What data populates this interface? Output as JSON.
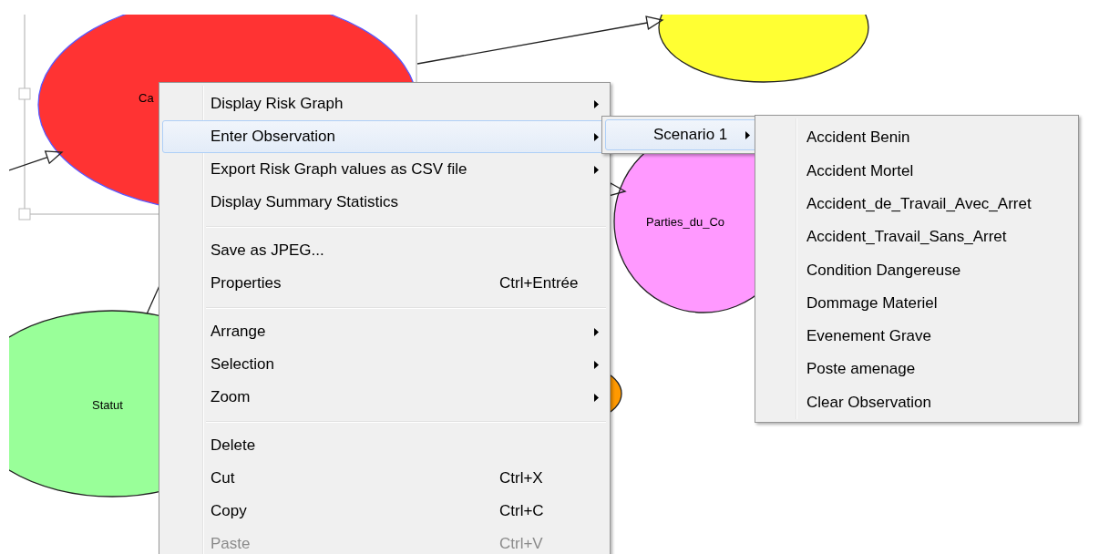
{
  "canvas": {
    "nodes": [
      {
        "label": "Ca",
        "color": "#ff3333",
        "selected": true
      },
      {
        "color": "#ffff33",
        "selected": false
      },
      {
        "label": "Parties_du_Co",
        "color": "#ff99ff",
        "selected": false
      },
      {
        "label": "Statut",
        "color": "#99ff99",
        "selected": false
      },
      {
        "color": "#ff9900",
        "selected": false
      }
    ]
  },
  "context_menu": {
    "items": [
      {
        "kind": "item",
        "label": "Display Risk Graph",
        "submenu": true,
        "highlighted": false,
        "disabled": false
      },
      {
        "kind": "item",
        "label": "Enter Observation",
        "submenu": true,
        "highlighted": true,
        "disabled": false
      },
      {
        "kind": "item",
        "label": "Export Risk Graph values as CSV file",
        "submenu": true,
        "highlighted": false,
        "disabled": false
      },
      {
        "kind": "item",
        "label": "Display Summary Statistics",
        "submenu": false,
        "highlighted": false,
        "disabled": false
      },
      {
        "kind": "separator"
      },
      {
        "kind": "item",
        "label": "Save as JPEG...",
        "submenu": false,
        "highlighted": false,
        "disabled": false
      },
      {
        "kind": "item",
        "label": "Properties",
        "shortcut": "Ctrl+Entrée",
        "submenu": false,
        "highlighted": false,
        "disabled": false
      },
      {
        "kind": "separator"
      },
      {
        "kind": "item",
        "label": "Arrange",
        "submenu": true,
        "highlighted": false,
        "disabled": false
      },
      {
        "kind": "item",
        "label": "Selection",
        "submenu": true,
        "highlighted": false,
        "disabled": false
      },
      {
        "kind": "item",
        "label": "Zoom",
        "submenu": true,
        "highlighted": false,
        "disabled": false
      },
      {
        "kind": "separator"
      },
      {
        "kind": "item",
        "label": "Delete",
        "submenu": false,
        "highlighted": false,
        "disabled": false
      },
      {
        "kind": "item",
        "label": "Cut",
        "shortcut": "Ctrl+X",
        "submenu": false,
        "highlighted": false,
        "disabled": false
      },
      {
        "kind": "item",
        "label": "Copy",
        "shortcut": "Ctrl+C",
        "submenu": false,
        "highlighted": false,
        "disabled": false
      },
      {
        "kind": "item",
        "label": "Paste",
        "shortcut": "Ctrl+V",
        "submenu": false,
        "highlighted": false,
        "disabled": true
      }
    ]
  },
  "scenario_menu": {
    "items": [
      {
        "label": "Scenario 1",
        "submenu": true,
        "highlighted": true
      }
    ]
  },
  "observation_menu": {
    "items": [
      {
        "label": "Accident Benin",
        "highlighted": false
      },
      {
        "label": "Accident Mortel",
        "highlighted": false
      },
      {
        "label": "Accident_de_Travail_Avec_Arret",
        "highlighted": false
      },
      {
        "label": "Accident_Travail_Sans_Arret",
        "highlighted": false
      },
      {
        "label": "Condition Dangereuse",
        "highlighted": false
      },
      {
        "label": "Dommage Materiel",
        "highlighted": false
      },
      {
        "label": "Evenement Grave",
        "highlighted": false
      },
      {
        "label": "Poste amenage",
        "highlighted": false
      },
      {
        "label": "Clear Observation",
        "highlighted": false
      }
    ]
  }
}
